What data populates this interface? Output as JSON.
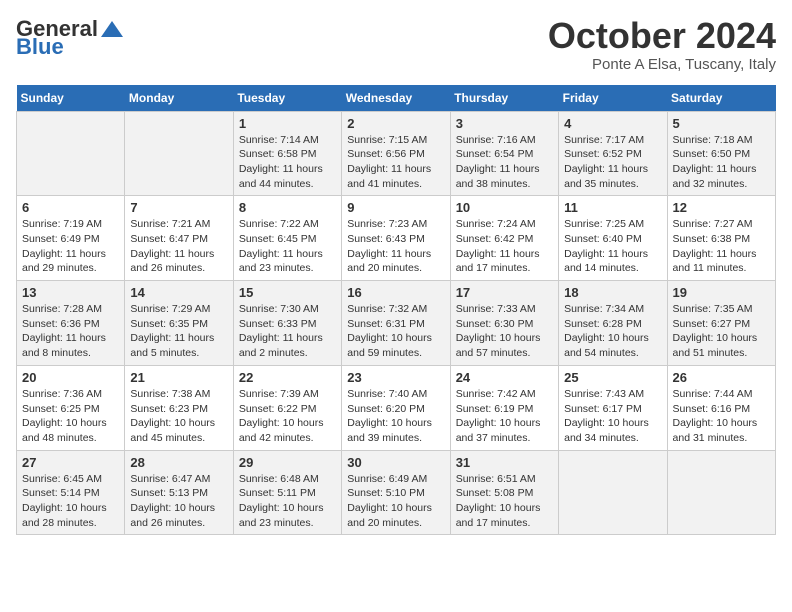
{
  "header": {
    "logo_general": "General",
    "logo_blue": "Blue",
    "month_title": "October 2024",
    "location": "Ponte A Elsa, Tuscany, Italy"
  },
  "days_of_week": [
    "Sunday",
    "Monday",
    "Tuesday",
    "Wednesday",
    "Thursday",
    "Friday",
    "Saturday"
  ],
  "weeks": [
    [
      {
        "day": "",
        "info": ""
      },
      {
        "day": "",
        "info": ""
      },
      {
        "day": "1",
        "info": "Sunrise: 7:14 AM\nSunset: 6:58 PM\nDaylight: 11 hours and 44 minutes."
      },
      {
        "day": "2",
        "info": "Sunrise: 7:15 AM\nSunset: 6:56 PM\nDaylight: 11 hours and 41 minutes."
      },
      {
        "day": "3",
        "info": "Sunrise: 7:16 AM\nSunset: 6:54 PM\nDaylight: 11 hours and 38 minutes."
      },
      {
        "day": "4",
        "info": "Sunrise: 7:17 AM\nSunset: 6:52 PM\nDaylight: 11 hours and 35 minutes."
      },
      {
        "day": "5",
        "info": "Sunrise: 7:18 AM\nSunset: 6:50 PM\nDaylight: 11 hours and 32 minutes."
      }
    ],
    [
      {
        "day": "6",
        "info": "Sunrise: 7:19 AM\nSunset: 6:49 PM\nDaylight: 11 hours and 29 minutes."
      },
      {
        "day": "7",
        "info": "Sunrise: 7:21 AM\nSunset: 6:47 PM\nDaylight: 11 hours and 26 minutes."
      },
      {
        "day": "8",
        "info": "Sunrise: 7:22 AM\nSunset: 6:45 PM\nDaylight: 11 hours and 23 minutes."
      },
      {
        "day": "9",
        "info": "Sunrise: 7:23 AM\nSunset: 6:43 PM\nDaylight: 11 hours and 20 minutes."
      },
      {
        "day": "10",
        "info": "Sunrise: 7:24 AM\nSunset: 6:42 PM\nDaylight: 11 hours and 17 minutes."
      },
      {
        "day": "11",
        "info": "Sunrise: 7:25 AM\nSunset: 6:40 PM\nDaylight: 11 hours and 14 minutes."
      },
      {
        "day": "12",
        "info": "Sunrise: 7:27 AM\nSunset: 6:38 PM\nDaylight: 11 hours and 11 minutes."
      }
    ],
    [
      {
        "day": "13",
        "info": "Sunrise: 7:28 AM\nSunset: 6:36 PM\nDaylight: 11 hours and 8 minutes."
      },
      {
        "day": "14",
        "info": "Sunrise: 7:29 AM\nSunset: 6:35 PM\nDaylight: 11 hours and 5 minutes."
      },
      {
        "day": "15",
        "info": "Sunrise: 7:30 AM\nSunset: 6:33 PM\nDaylight: 11 hours and 2 minutes."
      },
      {
        "day": "16",
        "info": "Sunrise: 7:32 AM\nSunset: 6:31 PM\nDaylight: 10 hours and 59 minutes."
      },
      {
        "day": "17",
        "info": "Sunrise: 7:33 AM\nSunset: 6:30 PM\nDaylight: 10 hours and 57 minutes."
      },
      {
        "day": "18",
        "info": "Sunrise: 7:34 AM\nSunset: 6:28 PM\nDaylight: 10 hours and 54 minutes."
      },
      {
        "day": "19",
        "info": "Sunrise: 7:35 AM\nSunset: 6:27 PM\nDaylight: 10 hours and 51 minutes."
      }
    ],
    [
      {
        "day": "20",
        "info": "Sunrise: 7:36 AM\nSunset: 6:25 PM\nDaylight: 10 hours and 48 minutes."
      },
      {
        "day": "21",
        "info": "Sunrise: 7:38 AM\nSunset: 6:23 PM\nDaylight: 10 hours and 45 minutes."
      },
      {
        "day": "22",
        "info": "Sunrise: 7:39 AM\nSunset: 6:22 PM\nDaylight: 10 hours and 42 minutes."
      },
      {
        "day": "23",
        "info": "Sunrise: 7:40 AM\nSunset: 6:20 PM\nDaylight: 10 hours and 39 minutes."
      },
      {
        "day": "24",
        "info": "Sunrise: 7:42 AM\nSunset: 6:19 PM\nDaylight: 10 hours and 37 minutes."
      },
      {
        "day": "25",
        "info": "Sunrise: 7:43 AM\nSunset: 6:17 PM\nDaylight: 10 hours and 34 minutes."
      },
      {
        "day": "26",
        "info": "Sunrise: 7:44 AM\nSunset: 6:16 PM\nDaylight: 10 hours and 31 minutes."
      }
    ],
    [
      {
        "day": "27",
        "info": "Sunrise: 6:45 AM\nSunset: 5:14 PM\nDaylight: 10 hours and 28 minutes."
      },
      {
        "day": "28",
        "info": "Sunrise: 6:47 AM\nSunset: 5:13 PM\nDaylight: 10 hours and 26 minutes."
      },
      {
        "day": "29",
        "info": "Sunrise: 6:48 AM\nSunset: 5:11 PM\nDaylight: 10 hours and 23 minutes."
      },
      {
        "day": "30",
        "info": "Sunrise: 6:49 AM\nSunset: 5:10 PM\nDaylight: 10 hours and 20 minutes."
      },
      {
        "day": "31",
        "info": "Sunrise: 6:51 AM\nSunset: 5:08 PM\nDaylight: 10 hours and 17 minutes."
      },
      {
        "day": "",
        "info": ""
      },
      {
        "day": "",
        "info": ""
      }
    ]
  ]
}
